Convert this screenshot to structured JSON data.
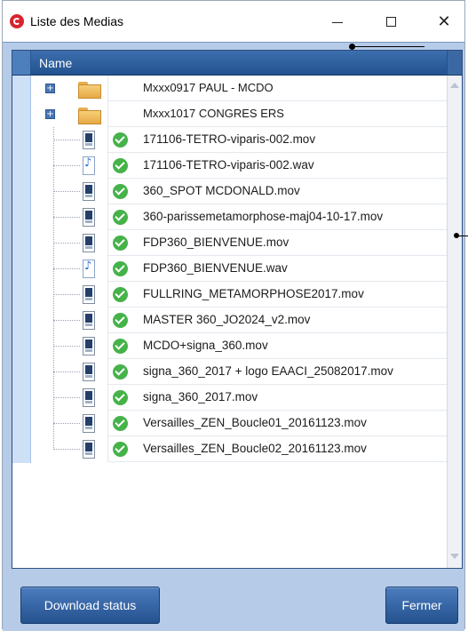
{
  "window": {
    "title": "Liste des Medias",
    "controls": {
      "minimize": "—",
      "maximize": "□",
      "close": "✕"
    }
  },
  "tree": {
    "column_header": "Name",
    "folders": [
      {
        "label": "Mxxx0917 PAUL - MCDO",
        "expander": "+"
      },
      {
        "label": "Mxxx1017 CONGRES ERS",
        "expander": "+"
      }
    ],
    "files": [
      {
        "label": "171106-TETRO-viparis-002.mov",
        "type": "video",
        "status": "ok"
      },
      {
        "label": "171106-TETRO-viparis-002.wav",
        "type": "audio",
        "status": "ok"
      },
      {
        "label": "360_SPOT MCDONALD.mov",
        "type": "video",
        "status": "ok"
      },
      {
        "label": "360-parissemetamorphose-maj04-10-17.mov",
        "type": "video",
        "status": "ok"
      },
      {
        "label": "FDP360_BIENVENUE.mov",
        "type": "video",
        "status": "ok"
      },
      {
        "label": "FDP360_BIENVENUE.wav",
        "type": "audio",
        "status": "ok"
      },
      {
        "label": "FULLRING_METAMORPHOSE2017.mov",
        "type": "video",
        "status": "ok"
      },
      {
        "label": "MASTER 360_JO2024_v2.mov",
        "type": "video",
        "status": "ok"
      },
      {
        "label": "MCDO+signa_360.mov",
        "type": "video",
        "status": "ok"
      },
      {
        "label": "signa_360_2017 + logo EAACI_25082017.mov",
        "type": "video",
        "status": "ok"
      },
      {
        "label": "signa_360_2017.mov",
        "type": "video",
        "status": "ok"
      },
      {
        "label": "Versailles_ZEN_Boucle01_20161123.mov",
        "type": "video",
        "status": "ok"
      },
      {
        "label": "Versailles_ZEN_Boucle02_20161123.mov",
        "type": "video",
        "status": "ok"
      }
    ]
  },
  "buttons": {
    "download_status": "Download status",
    "close": "Fermer"
  },
  "colors": {
    "header": "#23528f",
    "panel_bg": "#b5cbe8",
    "status_ok": "#46b24a",
    "button": "#25528f"
  }
}
